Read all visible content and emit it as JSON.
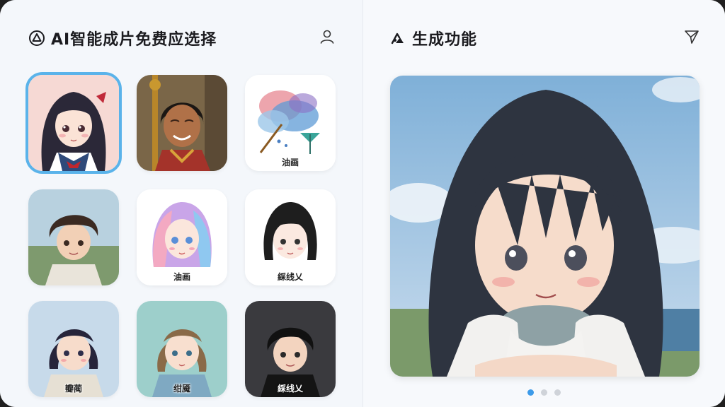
{
  "left": {
    "title": "AI智能成片免费应选择",
    "title_icon": "triangle-circle-icon",
    "profile_icon": "person-icon"
  },
  "right": {
    "title": "生成功能",
    "title_icon": "tools-icon",
    "send_icon": "paper-plane-icon"
  },
  "styles": [
    {
      "label": "",
      "selected": true
    },
    {
      "label": ""
    },
    {
      "label": "油画"
    },
    {
      "label": ""
    },
    {
      "label": "油画"
    },
    {
      "label": "綵线乂"
    },
    {
      "label": "瓣蔺"
    },
    {
      "label": "绀魇"
    },
    {
      "label": "綵线乂"
    }
  ],
  "pager": {
    "count": 3,
    "active": 0
  },
  "colors": {
    "accent": "#3d9be9",
    "selection": "#5ab3ea"
  }
}
